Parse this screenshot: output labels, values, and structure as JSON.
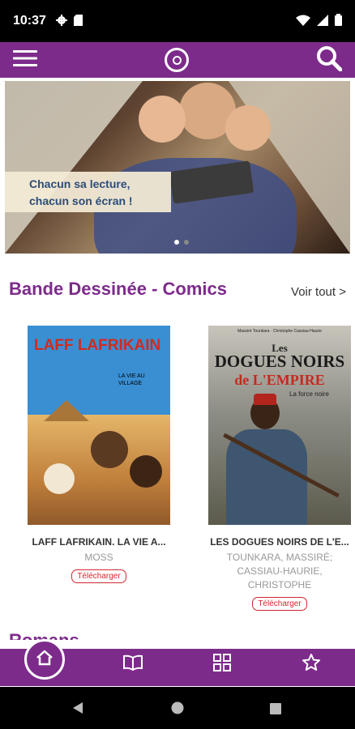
{
  "status_bar": {
    "time": "10:37"
  },
  "app_bar": {
    "menu_icon": "hamburger-menu-icon",
    "logo_icon": "app-logo-icon",
    "search_icon": "search-icon"
  },
  "hero": {
    "caption_line1": "Chacun sa lecture,",
    "caption_line2": "chacun son écran !"
  },
  "section": {
    "title": "Bande Dessinée - Comics",
    "see_all": "Voir tout >"
  },
  "books": [
    {
      "cover_title": "LAFF LAFRIKAIN",
      "cover_subtitle": "LA VIE AU VILLAGE",
      "title": "LAFF LAFRIKAIN. LA VIE A...",
      "author": "MOSS",
      "download": "Télécharger"
    },
    {
      "cover_authors": "Massiré Tounkara · Christophe Cassiau-Haurie",
      "cover_title_1": "Les",
      "cover_title_2": "DOGUES NOIRS",
      "cover_title_3": "de L'EMPIRE",
      "cover_subtitle": "La force noire",
      "title": "LES DOGUES NOIRS DE L'E...",
      "author": "TOUNKARA, MASSIRÉ; CASSIAU-HAURIE, CHRISTOPHE",
      "download": "Télécharger"
    }
  ],
  "next_section": {
    "title": "Romans"
  },
  "colors": {
    "brand": "#7d2b8b",
    "download": "#d5262f",
    "caption_text": "#2c4d7a"
  }
}
